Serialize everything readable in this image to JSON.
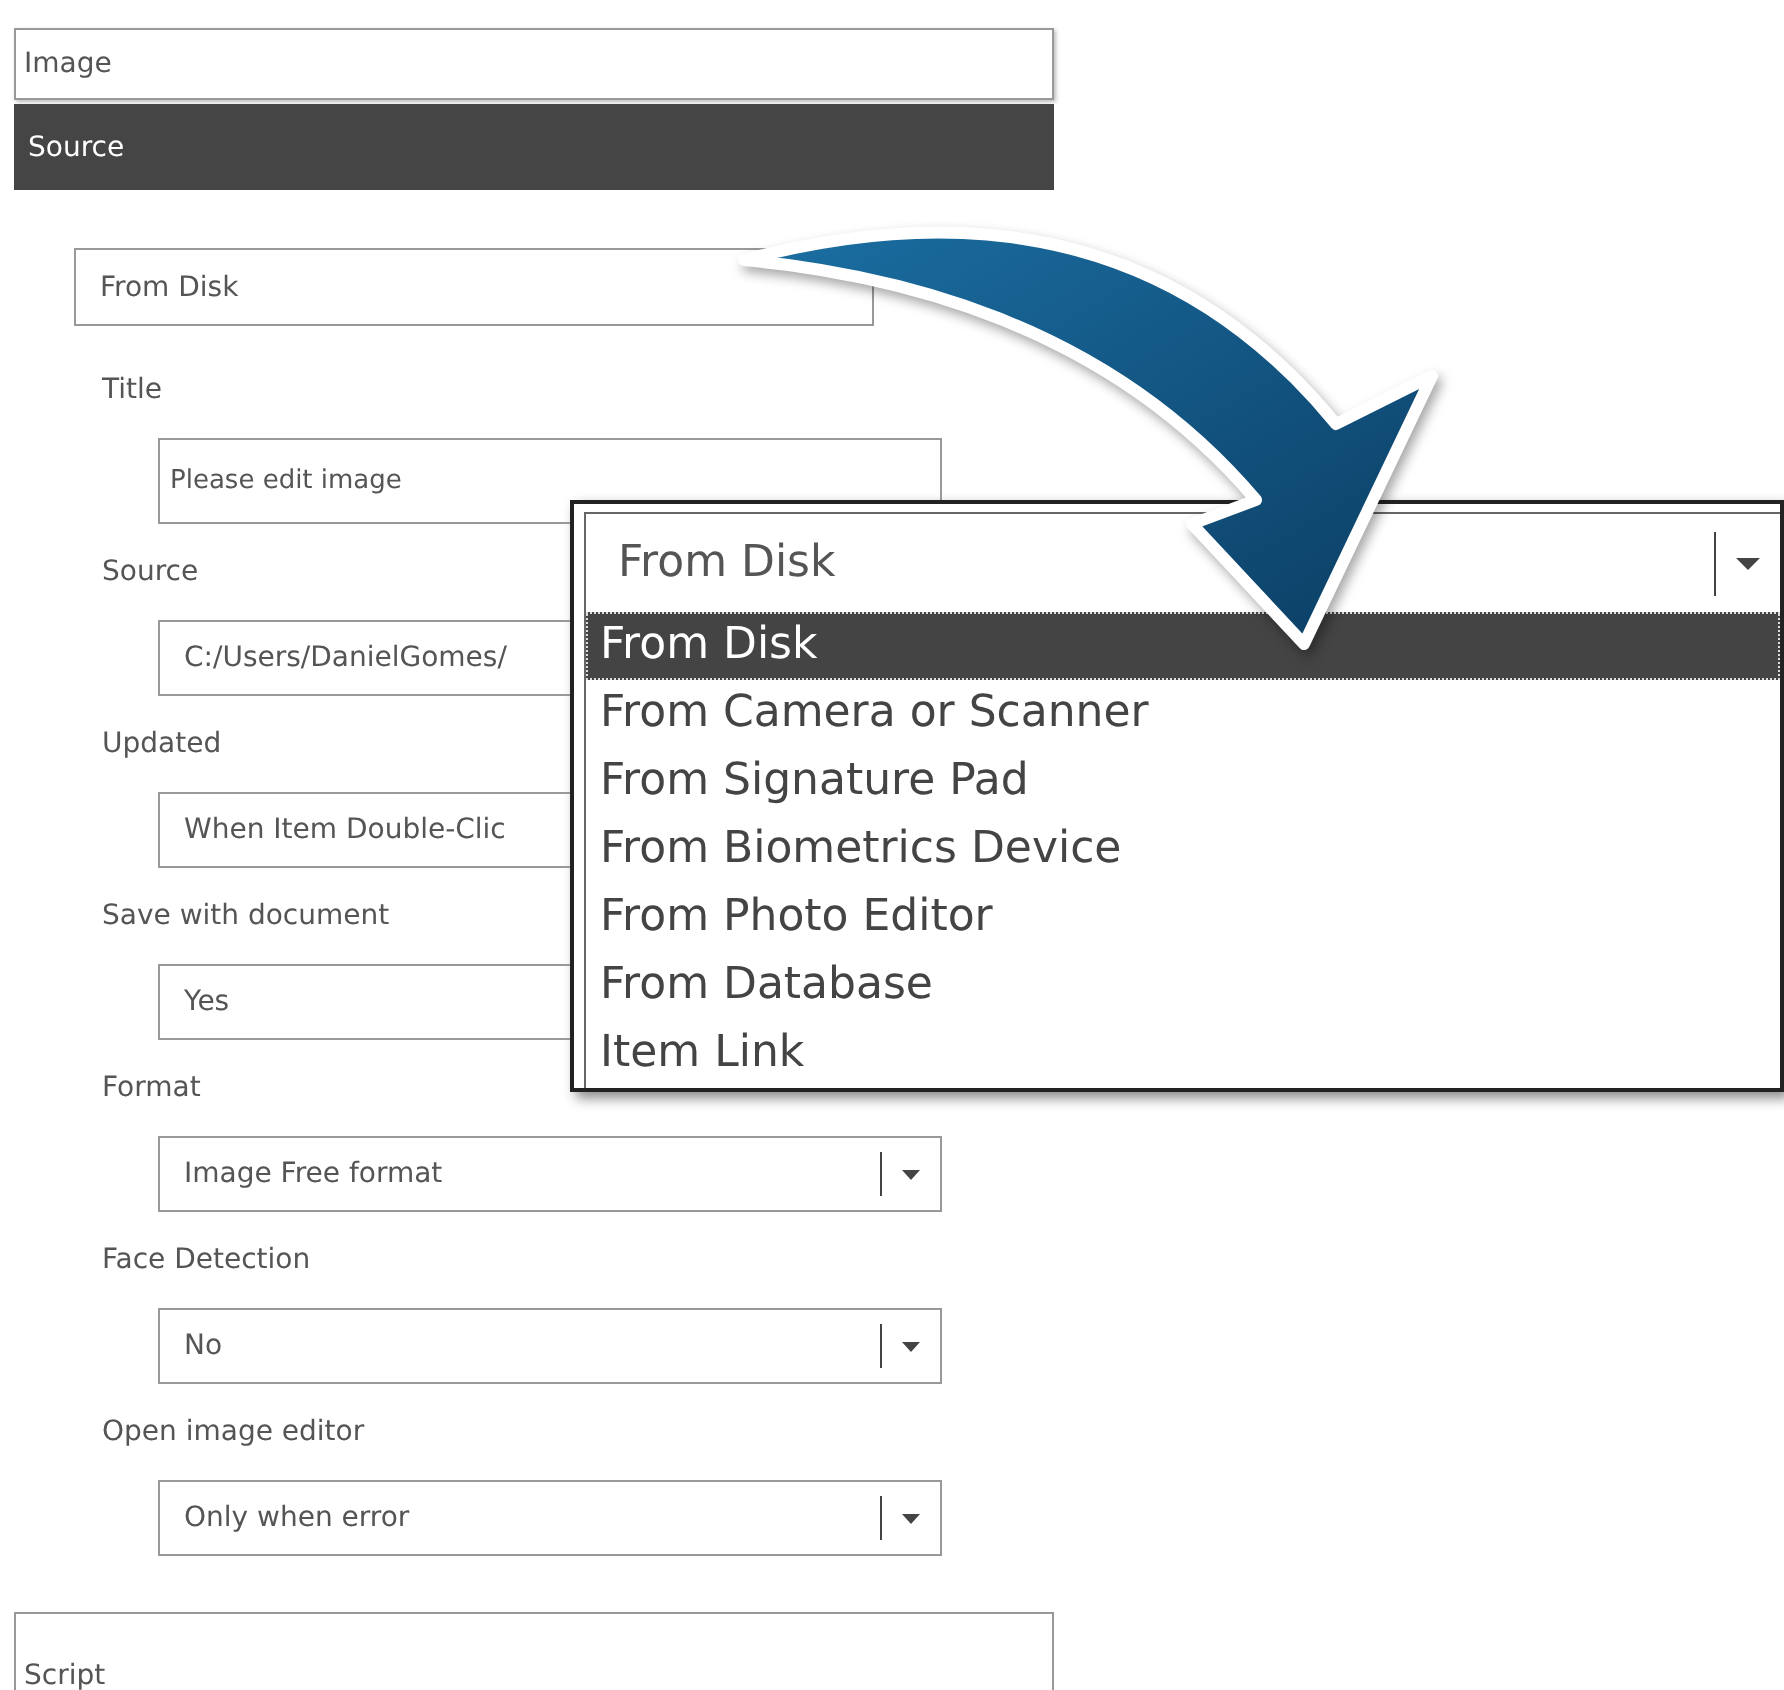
{
  "panel_header": {
    "title": "Image"
  },
  "section_bar": {
    "title": "Source"
  },
  "source_select": {
    "value": "From Disk"
  },
  "fields": [
    {
      "label": "Title",
      "kind": "text",
      "value": "Please edit image"
    },
    {
      "label": "Source",
      "kind": "text",
      "value": "C:/Users/DanielGomes/"
    },
    {
      "label": "Updated",
      "kind": "text",
      "value": "When Item Double-Clic"
    },
    {
      "label": "Save with document",
      "kind": "text",
      "value": "Yes"
    },
    {
      "label": "Format",
      "kind": "select",
      "value": "Image Free format"
    },
    {
      "label": "Face Detection",
      "kind": "select",
      "value": "No"
    },
    {
      "label": "Open image editor",
      "kind": "select",
      "value": "Only when error"
    }
  ],
  "dropdown_popup": {
    "value": "From Disk",
    "options": [
      {
        "label": "From Disk",
        "selected": true
      },
      {
        "label": "From Camera or Scanner",
        "selected": false
      },
      {
        "label": "From Signature Pad",
        "selected": false
      },
      {
        "label": "From Biometrics Device",
        "selected": false
      },
      {
        "label": "From Photo Editor",
        "selected": false
      },
      {
        "label": "From Database",
        "selected": false
      },
      {
        "label": "Item Link",
        "selected": false
      }
    ]
  },
  "script_header": {
    "title": "Script"
  }
}
